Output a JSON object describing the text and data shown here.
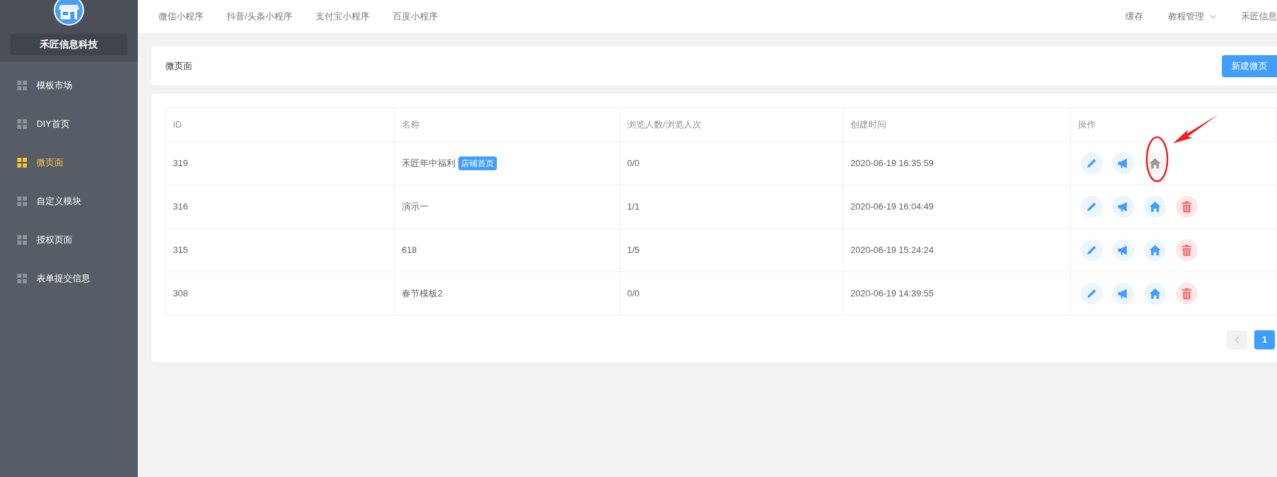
{
  "sidebar": {
    "brand": "禾匠信息科技",
    "items": [
      {
        "label": "模板市场",
        "selected": false
      },
      {
        "label": "DIY首页",
        "selected": false
      },
      {
        "label": "微页面",
        "selected": true
      },
      {
        "label": "自定义模块",
        "selected": false
      },
      {
        "label": "授权页面",
        "selected": false
      },
      {
        "label": "表单提交信息",
        "selected": false
      }
    ]
  },
  "top_nav": {
    "left": [
      "微信小程序",
      "抖音/头条小程序",
      "支付宝小程序",
      "百度小程序"
    ],
    "right": [
      {
        "label": "缓存",
        "dropdown": false
      },
      {
        "label": "教程管理",
        "dropdown": true
      },
      {
        "label": "禾匠信息",
        "dropdown": false
      }
    ]
  },
  "header": {
    "title": "微页面",
    "button": "新建微页"
  },
  "table": {
    "columns": [
      "ID",
      "名称",
      "浏览人数/浏览人次",
      "创建时间",
      "操作"
    ],
    "rows": [
      {
        "id": "319",
        "name": "禾匠年中福利",
        "tag": "店铺首页",
        "views": "0/0",
        "created": "2020-06-19 16:35:59",
        "actions": [
          {
            "kind": "edit",
            "disabled": false
          },
          {
            "kind": "promote",
            "disabled": false
          },
          {
            "kind": "home",
            "disabled": true
          }
        ]
      },
      {
        "id": "316",
        "name": "演示一",
        "views": "1/1",
        "created": "2020-06-19 16:04:49",
        "actions": [
          {
            "kind": "edit",
            "disabled": false
          },
          {
            "kind": "promote",
            "disabled": false
          },
          {
            "kind": "home",
            "disabled": false
          },
          {
            "kind": "delete",
            "disabled": false
          }
        ]
      },
      {
        "id": "315",
        "name": "618",
        "views": "1/5",
        "created": "2020-06-19 15:24:24",
        "actions": [
          {
            "kind": "edit",
            "disabled": false
          },
          {
            "kind": "promote",
            "disabled": false
          },
          {
            "kind": "home",
            "disabled": false
          },
          {
            "kind": "delete",
            "disabled": false
          }
        ]
      },
      {
        "id": "308",
        "name": "春节模板2",
        "views": "0/0",
        "created": "2020-06-19 14:39:55",
        "actions": [
          {
            "kind": "edit",
            "disabled": false
          },
          {
            "kind": "promote",
            "disabled": false
          },
          {
            "kind": "home",
            "disabled": false
          },
          {
            "kind": "delete",
            "disabled": false
          }
        ]
      }
    ]
  },
  "pagination": {
    "pages": [
      {
        "label": "1",
        "selected": true
      }
    ]
  }
}
